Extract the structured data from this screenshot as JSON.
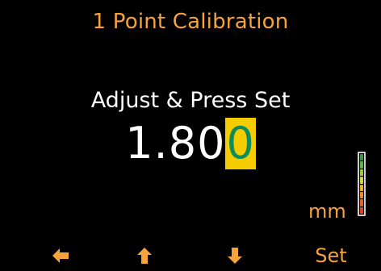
{
  "screen": {
    "title": "1 Point Calibration",
    "prompt": "Adjust & Press Set"
  },
  "reading": {
    "fixed_part": "1.80",
    "active_digit": "0",
    "unit": "mm"
  },
  "level_meter": {
    "segments": [
      "#2e9e46",
      "#5fb83c",
      "#9ccc32",
      "#d6d22a",
      "#f0b021",
      "#ee8a1c",
      "#e8621a",
      "#e0401a"
    ]
  },
  "softkeys": {
    "left_icon": "arrow-left-icon",
    "up_icon": "arrow-up-icon",
    "down_icon": "arrow-down-icon",
    "set_label": "Set"
  },
  "colors": {
    "accent": "#f5a33a",
    "cursor_bg": "#f4cc00",
    "cursor_fg": "#0f8c5c",
    "background": "#000000"
  }
}
